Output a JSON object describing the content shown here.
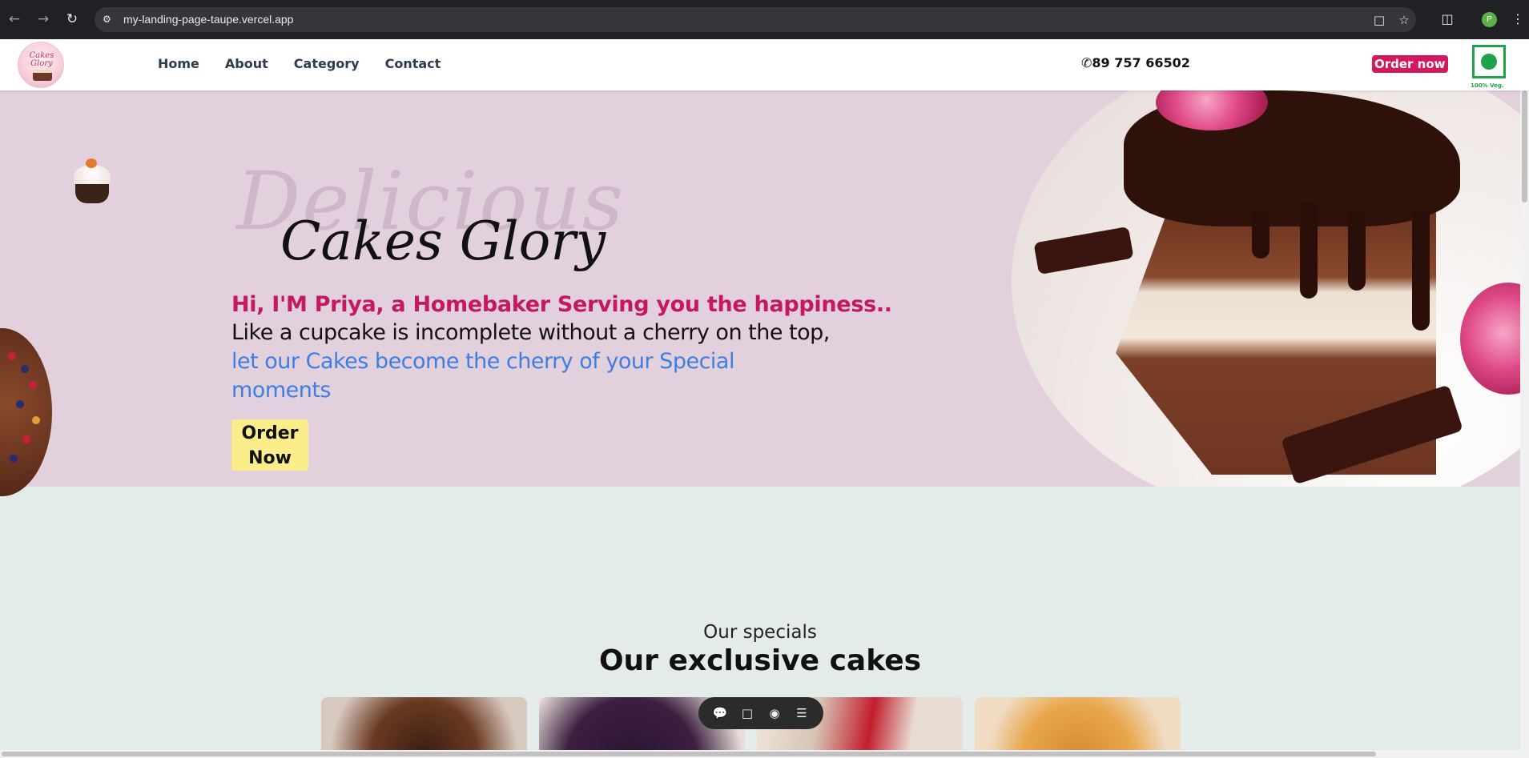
{
  "browser": {
    "url": "my-landing-page-taupe.vercel.app",
    "profile_initial": "P",
    "icons": {
      "back": "arrow-left-icon",
      "forward": "arrow-right-icon",
      "reload": "reload-icon",
      "site_info": "tune-icon",
      "install": "install-app-icon",
      "bookmark": "star-icon",
      "extensions": "puzzle-icon",
      "menu": "kebab-menu-icon"
    }
  },
  "header": {
    "logo_text": "Cakes Glory",
    "nav": [
      "Home",
      "About",
      "Category",
      "Contact"
    ],
    "phone": "89 757 66502",
    "order_label": "Order now",
    "veg_label": "100% Veg."
  },
  "hero": {
    "script_background": "Delicious",
    "script_title": "Cakes Glory",
    "heading": "Hi, I'M Priya, a Homebaker Serving you the happiness..",
    "paragraph_main": "Like a cupcake is incomplete without a cherry on the top, ",
    "paragraph_highlight": "let our Cakes become the cherry of your Special moments",
    "order_line1": "Order",
    "order_line2": "Now"
  },
  "specials": {
    "subtitle": "Our specials",
    "title": "Our exclusive cakes"
  },
  "toolbar": {
    "icons": [
      "comment-icon",
      "inbox-icon",
      "eye-icon",
      "menu-icon"
    ]
  },
  "colors": {
    "accent_pink": "#c4195b",
    "order_button": "#d4185f",
    "highlight_blue": "#3d7fe0",
    "hero_bg": "#e2d0dc",
    "section_bg": "#e4ecea",
    "cta_yellow": "#fbed8a",
    "veg_green": "#1fa24a"
  }
}
